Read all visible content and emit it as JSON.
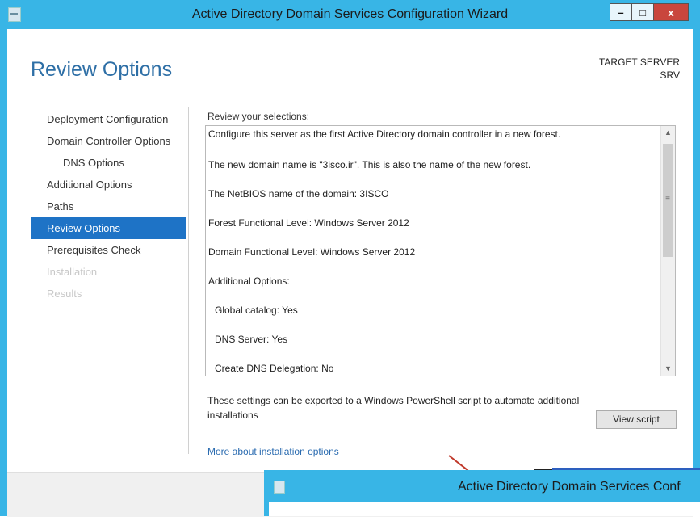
{
  "window": {
    "title": "Active Directory Domain Services Configuration Wizard",
    "buttons": {
      "minimize": "–",
      "maximize": "□",
      "close": "x"
    }
  },
  "page": {
    "heading": "Review Options",
    "target_label": "TARGET SERVER",
    "target_value": "SRV"
  },
  "nav": {
    "items": [
      {
        "label": "Deployment Configuration",
        "state": "normal"
      },
      {
        "label": "Domain Controller Options",
        "state": "normal"
      },
      {
        "label": "DNS Options",
        "state": "normal"
      },
      {
        "label": "Additional Options",
        "state": "normal"
      },
      {
        "label": "Paths",
        "state": "normal"
      },
      {
        "label": "Review Options",
        "state": "active"
      },
      {
        "label": "Prerequisites Check",
        "state": "normal"
      },
      {
        "label": "Installation",
        "state": "disabled"
      },
      {
        "label": "Results",
        "state": "disabled"
      }
    ]
  },
  "review": {
    "label": "Review your selections:",
    "lines": [
      "Configure this server as the first Active Directory domain controller in a new forest.",
      "The new domain name is \"3isco.ir\". This is also the name of the new forest.",
      "The NetBIOS name of the domain: 3ISCO",
      "Forest Functional Level: Windows Server 2012",
      "Domain Functional Level: Windows Server 2012",
      "Additional Options:",
      "Global catalog: Yes",
      "DNS Server: Yes",
      "Create DNS Delegation: No"
    ]
  },
  "export": {
    "text": "These settings can be exported to a Windows PowerShell script to automate additional installations",
    "view_script_label": "View script"
  },
  "more_link": "More about installation options",
  "overlay": {
    "title": "Active Directory Domain Services Conf"
  }
}
